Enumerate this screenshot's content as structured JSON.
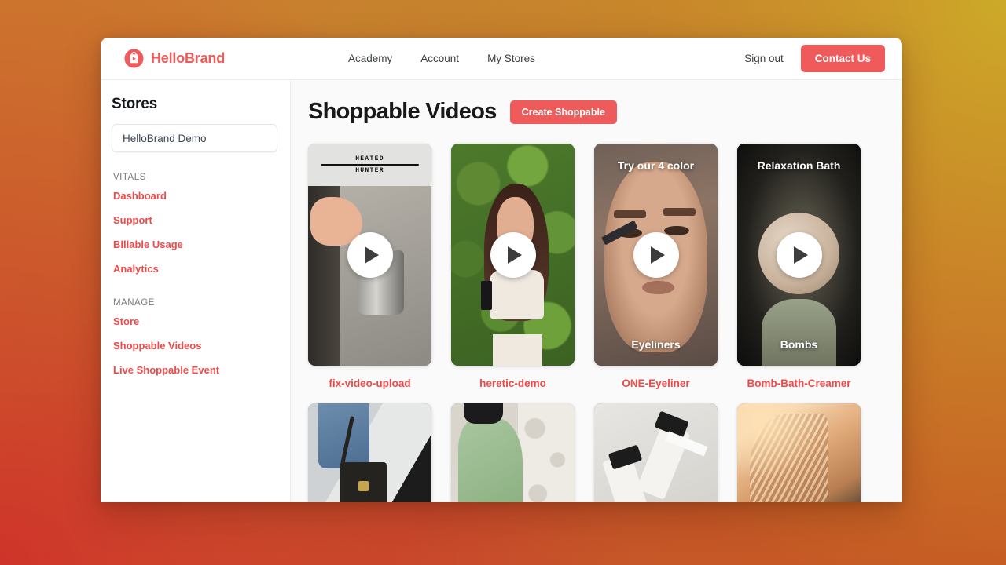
{
  "brand": {
    "name": "HelloBrand",
    "logo_icon": "shopping-bag-play-icon",
    "accent_color": "#ef5b5b"
  },
  "topnav": {
    "links": [
      {
        "label": "Academy"
      },
      {
        "label": "Account"
      },
      {
        "label": "My Stores"
      }
    ],
    "signout_label": "Sign out",
    "contact_label": "Contact Us"
  },
  "sidebar": {
    "title": "Stores",
    "store_select": {
      "value": "HelloBrand Demo",
      "icon": "chevron-down-icon"
    },
    "groups": [
      {
        "heading": "VITALS",
        "items": [
          {
            "label": "Dashboard"
          },
          {
            "label": "Support"
          },
          {
            "label": "Billable Usage"
          },
          {
            "label": "Analytics"
          }
        ]
      },
      {
        "heading": "MANAGE",
        "items": [
          {
            "label": "Store"
          },
          {
            "label": "Shoppable Videos"
          },
          {
            "label": "Live Shoppable Event"
          }
        ]
      }
    ]
  },
  "main": {
    "page_title": "Shoppable Videos",
    "create_button_label": "Create Shoppable",
    "play_icon": "play-icon",
    "videos_row1": [
      {
        "label": "fix-video-upload",
        "overlay_top": "",
        "overlay_bottom": "",
        "art": "art-heated",
        "banner_top": "HEATED",
        "banner_bottom": "HUNTER"
      },
      {
        "label": "heretic-demo",
        "overlay_top": "",
        "overlay_bottom": "",
        "art": "art-heretic"
      },
      {
        "label": "ONE-Eyeliner",
        "overlay_top": "Try our 4 color",
        "overlay_bottom": "Eyeliners",
        "art": "art-eyeliner"
      },
      {
        "label": "Bomb-Bath-Creamer",
        "overlay_top": "Relaxation Bath",
        "overlay_bottom": "Bombs",
        "art": "art-bomb"
      }
    ],
    "videos_row2": [
      {
        "art": "art-bag"
      },
      {
        "art": "art-leggings"
      },
      {
        "art": "art-skincare"
      },
      {
        "art": "art-hair"
      }
    ]
  },
  "colors": {
    "accent_red": "#ef5b5b",
    "link_red": "#ef4a4a",
    "page_bg": "#fafafa",
    "backdrop_gradient_from": "#cb7c2e",
    "backdrop_gradient_to": "#c4522c"
  }
}
